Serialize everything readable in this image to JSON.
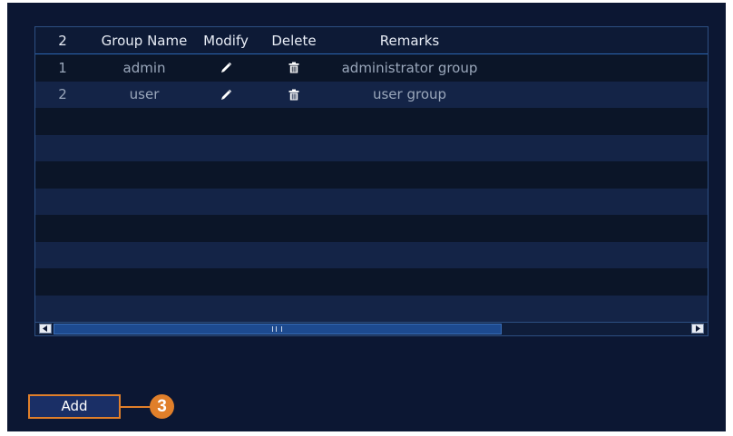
{
  "table": {
    "header": {
      "count": "2",
      "group_name": "Group Name",
      "modify": "Modify",
      "delete": "Delete",
      "remarks": "Remarks"
    },
    "rows": [
      {
        "no": "1",
        "name": "admin",
        "remarks": "administrator group",
        "modify_icon": "pencil-icon",
        "delete_icon": "trash-icon"
      },
      {
        "no": "2",
        "name": "user",
        "remarks": "user group",
        "modify_icon": "pencil-icon",
        "delete_icon": "trash-icon"
      }
    ],
    "empty_row_count": 8
  },
  "scrollbar": {
    "left_icon": "arrow-left-icon",
    "right_icon": "arrow-right-icon",
    "grip_icon": "grip-icon"
  },
  "add_button": {
    "label": "Add"
  },
  "callout": {
    "number": "3"
  },
  "colors": {
    "panel_bg": "#0c1733",
    "header_separator": "#2b66b3",
    "accent_orange": "#e07f2a",
    "row_alt": "#142447"
  }
}
